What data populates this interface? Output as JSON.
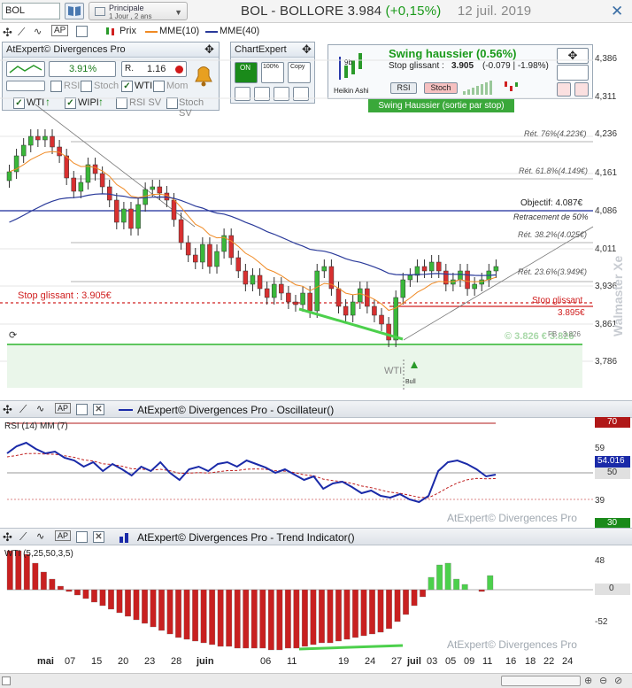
{
  "header": {
    "symbol": "BOL",
    "period_line1": "Principale",
    "period_line2": "1 Jour , 2 ans",
    "title": "BOL - BOLLORE",
    "price": "3.984",
    "change": "(+0,15%)",
    "date": "12 juil. 2019"
  },
  "legend": {
    "price_label": "Prix",
    "mme10": "MME(10)",
    "mme40": "MME(40)",
    "colors": {
      "mme10": "#f08a24",
      "mme40": "#2a3a9a"
    }
  },
  "atexpert_panel": {
    "title": "AtExpert© Divergences Pro",
    "pct": "3.91%",
    "ratio": "1.16",
    "ratio_label": "R.",
    "rsi": "RSI",
    "stoch": "Stoch",
    "wti": "WTI",
    "mom": "Mom",
    "wti_row": "WTI",
    "wipi_row": "WIPI",
    "rsi_sv": "RSI SV",
    "stoch_sv": "Stoch SV"
  },
  "chartexpert_panel": {
    "title": "ChartExpert",
    "on_label": "ON",
    "pct_label": "100%",
    "copy_label": "Copy"
  },
  "swing_panel": {
    "heikin": "Heikin Ashi",
    "ha_value": "9b",
    "title": "Swing haussier (0.56%)",
    "stop_label": "Stop glissant :",
    "stop_value": "3.905",
    "stop_change": "(-0.079 | -1.98%)",
    "rsi": "RSI",
    "stoch": "Stoch",
    "tag": "Swing Haussier (sortie par stop)"
  },
  "price_chart": {
    "y_labels": [
      "4,386",
      "4,311",
      "4,236",
      "4,161",
      "4,086",
      "4,011",
      "3,936",
      "3,861",
      "3,786"
    ],
    "fib": {
      "r76": "Rét. 76%(4.223€)",
      "r61": "Rét. 61.8%(4.149€)",
      "objectif": "Objectif: 4.087€",
      "retr50": "Retracement de 50%",
      "r38": "Rét. 38.2%(4.025€)",
      "r23": "Rét. 23.6%(3.949€)",
      "stop_left": "Stop glissant : 3.905€",
      "stop_right": "Stop glissant",
      "stop_right_val": "3.895€",
      "support": "© 3.826 € 3.826",
      "fb": "FB : 3.826"
    },
    "wti_mark": "WTI",
    "bull_mark": "Bull"
  },
  "osc_panel": {
    "title": "AtExpert© Divergences Pro - Oscillateur()",
    "label": "RSI (14) MM (7)",
    "y_labels": [
      "70",
      "59",
      "54.016",
      "50",
      "39",
      "30"
    ],
    "watermark": "AtExpert© Divergences Pro"
  },
  "trend_panel": {
    "title": "AtExpert© Divergences Pro - Trend Indicator()",
    "label": "WTI (5,25,50,3,5)",
    "y_labels": [
      "48",
      "0",
      "-52"
    ],
    "watermark": "AtExpert© Divergences Pro"
  },
  "x_axis": {
    "labels": [
      "mai",
      "07",
      "15",
      "20",
      "23",
      "28",
      "juin",
      "06",
      "11",
      "19",
      "24",
      "27",
      "juil",
      "03",
      "05",
      "09",
      "11",
      "16",
      "18",
      "22",
      "24"
    ]
  },
  "watermark_side": "Walmaster Xe"
}
